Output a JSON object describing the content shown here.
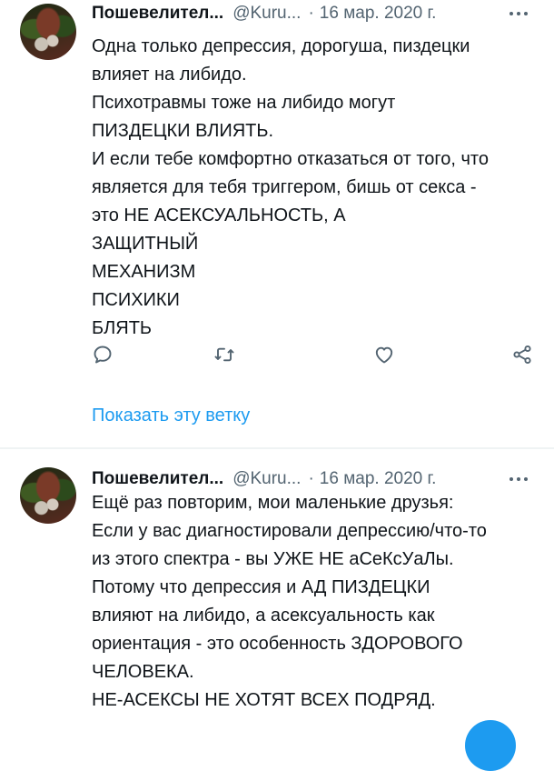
{
  "tweets": [
    {
      "name": "Пошевелител...",
      "handle": "@Kuru...",
      "separator": "·",
      "date": "16 мар. 2020 г.",
      "lines": [
        "Одна только депрессия, дорогуша, пиздецки",
        "влияет на либидо.",
        "Психотравмы тоже на либидо могут",
        "ПИЗДЕЦКИ ВЛИЯТЬ.",
        "И если тебе комфортно отказаться от того, что",
        "является для тебя триггером, бишь от секса -",
        "это НЕ АСЕКСУАЛЬНОСТЬ, А",
        "ЗАЩИТНЫЙ",
        "МЕХАНИЗМ",
        "ПСИХИКИ",
        "БЛЯТЬ"
      ],
      "show_thread": "Показать эту ветку"
    },
    {
      "name": "Пошевелител...",
      "handle": "@Kuru...",
      "separator": "·",
      "date": "16 мар. 2020 г.",
      "lines": [
        "Ещё раз повторим, мои маленькие друзья:",
        "Если у вас диагностировали депрессию/что-то",
        "из этого спектра - вы УЖЕ НЕ аСеКсУаЛы.",
        "Потому что депрессия и АД ПИЗДЕЦКИ",
        "влияют на либидо, а асексуальность как",
        "ориентация - это особенность ЗДОРОВОГО",
        "ЧЕЛОВЕКА.",
        "НЕ-АСЕКСЫ НЕ ХОТЯТ ВСЕХ ПОДРЯД."
      ]
    }
  ],
  "icons": {
    "reply": "reply-icon",
    "retweet": "retweet-icon",
    "like": "heart-icon",
    "share": "share-icon",
    "more": "more-icon"
  },
  "colors": {
    "text": "#0f1419",
    "secondary": "#536471",
    "accent": "#1d9bf0",
    "divider": "#eff3f4"
  }
}
